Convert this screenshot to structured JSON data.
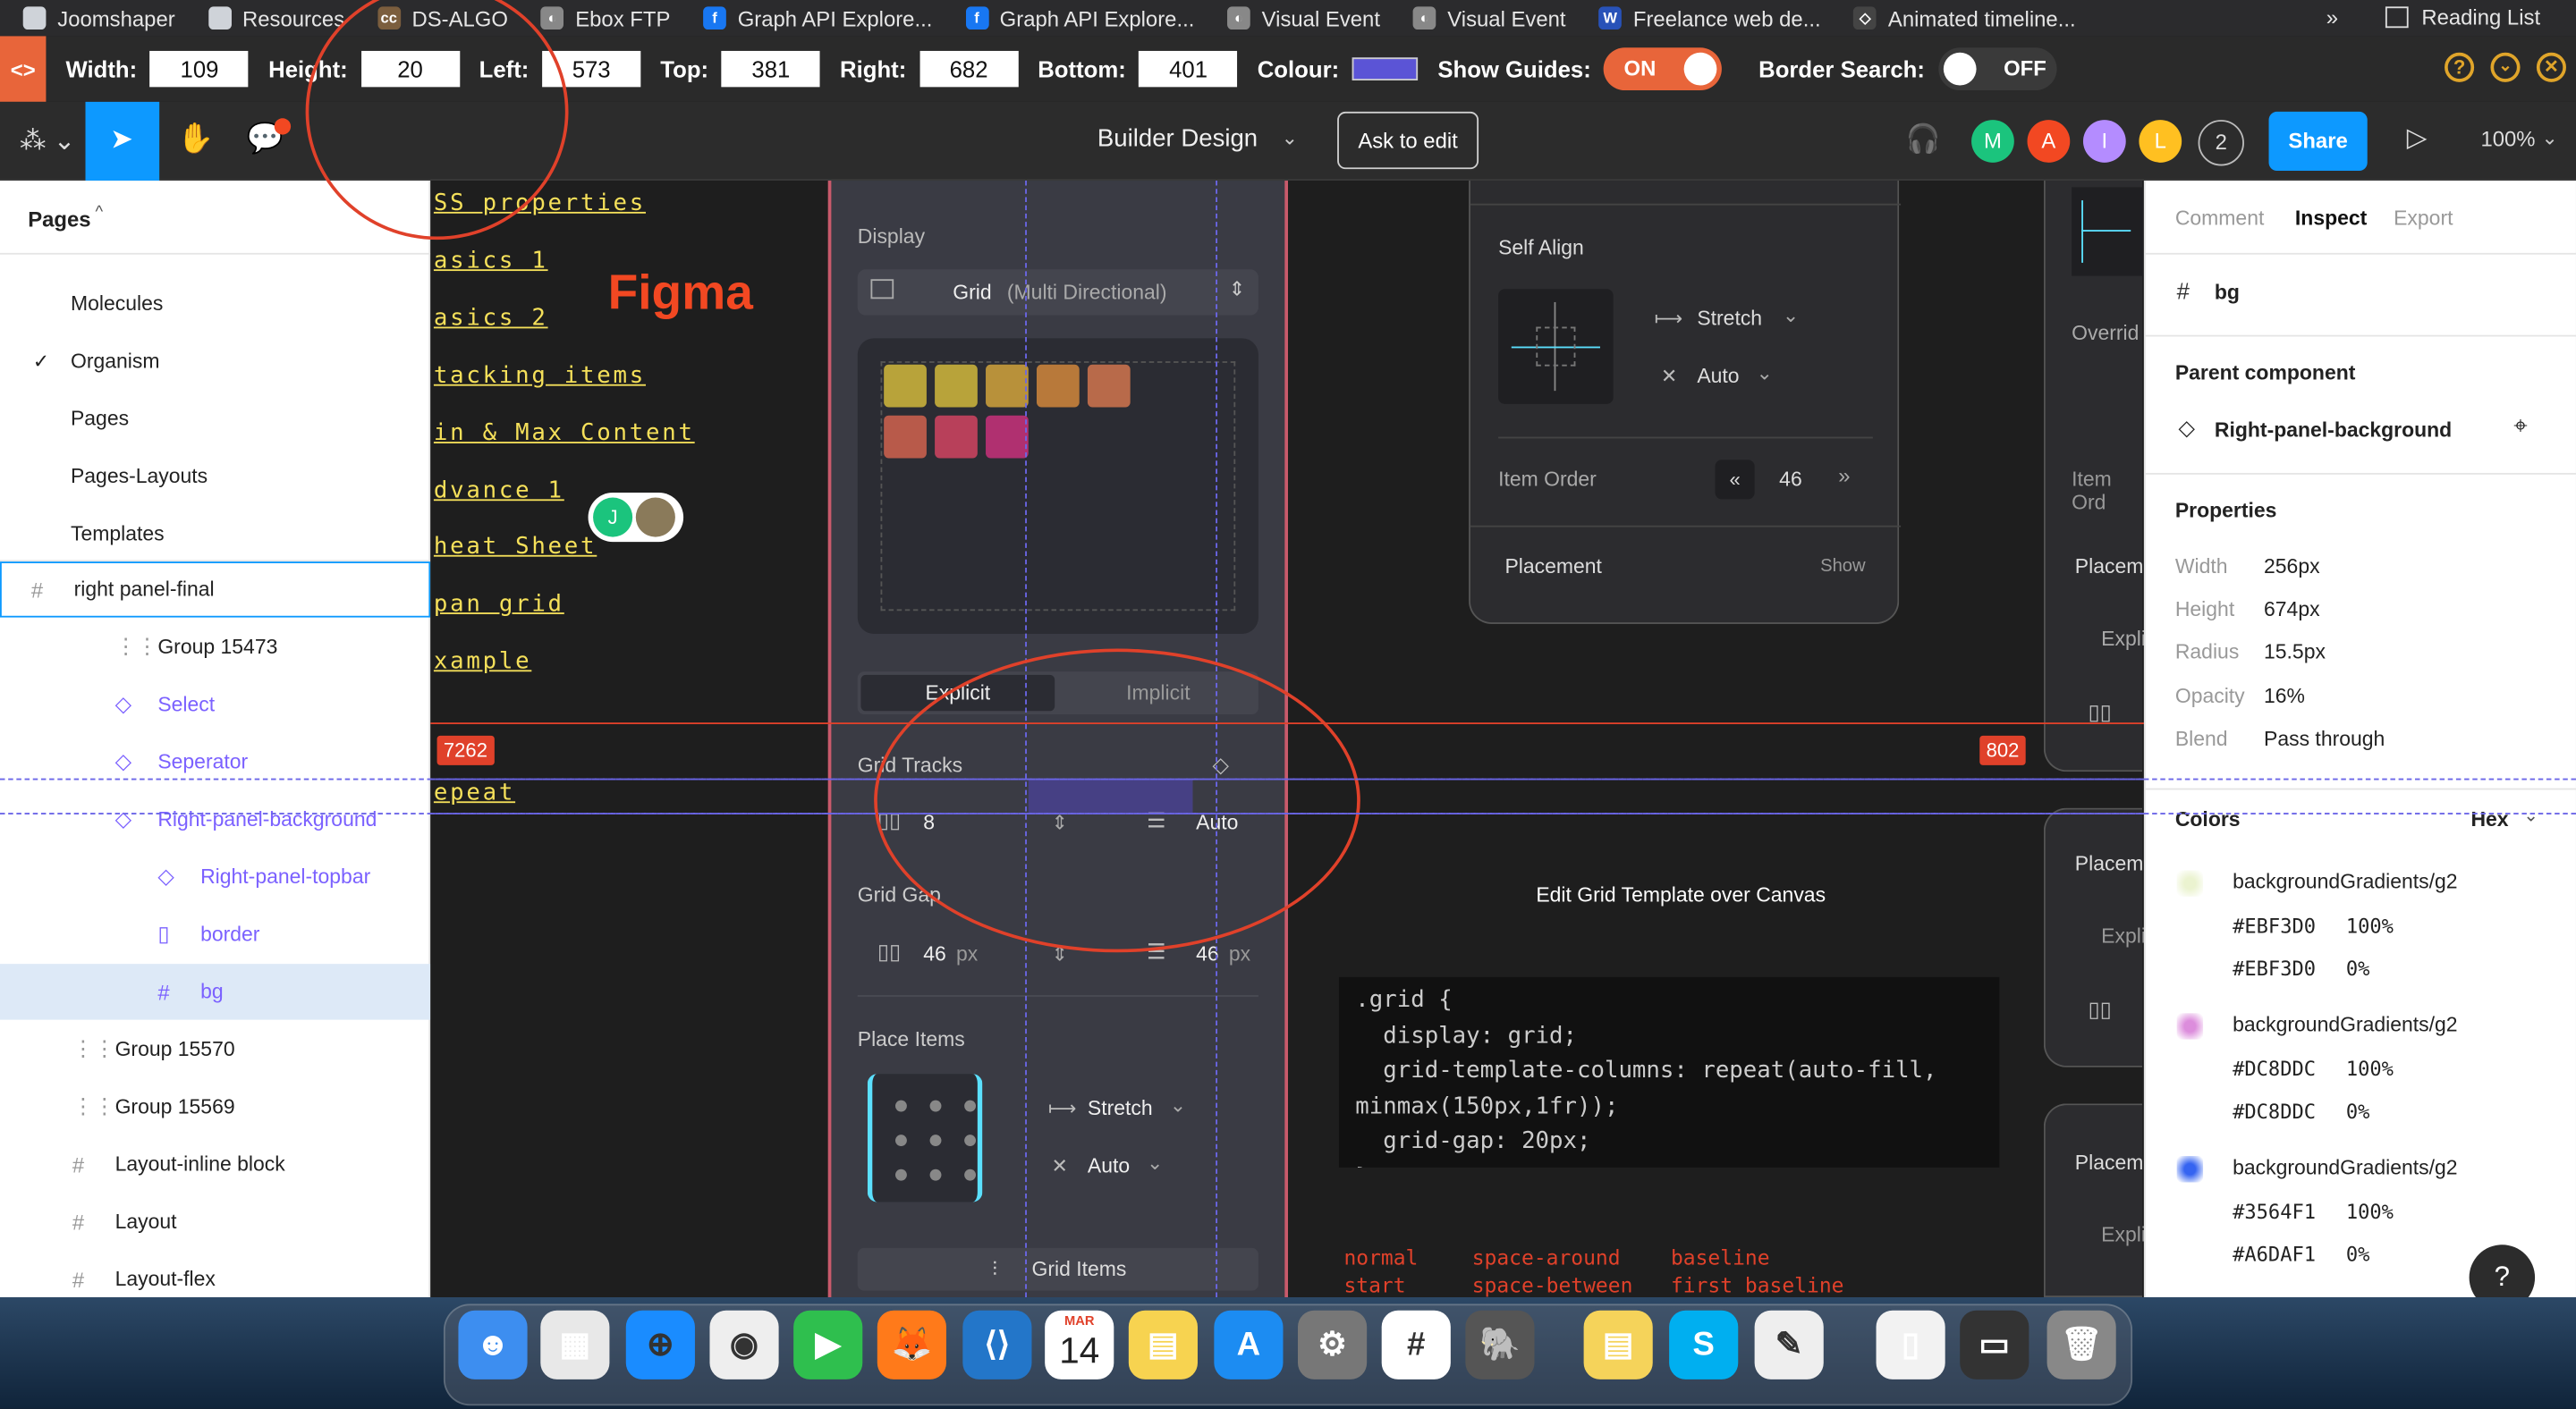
{
  "bookmarks": [
    {
      "label": "Joomshaper",
      "icon": "folder-icon"
    },
    {
      "label": "Resources",
      "icon": "folder-icon"
    },
    {
      "label": "DS-ALGO",
      "icon": "codechef-icon"
    },
    {
      "label": "Ebox FTP",
      "icon": "globe-icon"
    },
    {
      "label": "Graph API Explore...",
      "icon": "facebook-icon"
    },
    {
      "label": "Graph API Explore...",
      "icon": "facebook-icon"
    },
    {
      "label": "Visual Event",
      "icon": "globe-icon"
    },
    {
      "label": "Visual Event",
      "icon": "globe-icon"
    },
    {
      "label": "Freelance web de...",
      "icon": "w-icon"
    },
    {
      "label": "Animated timeline...",
      "icon": "codepen-icon"
    }
  ],
  "bookmarks_more": "»",
  "reading_list": "Reading List",
  "ext": {
    "width_label": "Width:",
    "width": "109",
    "height_label": "Height:",
    "height": "20",
    "left_label": "Left:",
    "left": "573",
    "top_label": "Top:",
    "top": "381",
    "right_label": "Right:",
    "right": "682",
    "bottom_label": "Bottom:",
    "bottom": "401",
    "colour_label": "Colour:",
    "colour": "#5b54d6",
    "guides_label": "Show Guides:",
    "guides": "ON",
    "border_label": "Border Search:",
    "border": "OFF"
  },
  "toolbar": {
    "title": "Builder Design",
    "ask": "Ask to edit",
    "share": "Share",
    "zoom": "100%",
    "avatars": [
      "M",
      "A",
      "I",
      "L"
    ],
    "count": "2"
  },
  "left": {
    "header": "Pages",
    "pages": [
      "Molecules",
      "Organism",
      "Pages",
      "Pages-Layouts",
      "Templates"
    ],
    "layers": [
      {
        "label": "right panel-final",
        "icon": "frame-icon",
        "indent": 0,
        "color": "#222"
      },
      {
        "label": "Group 15473",
        "icon": "group-icon",
        "indent": 1,
        "color": "#222"
      },
      {
        "label": "Select",
        "icon": "component-icon",
        "indent": 1,
        "color": "#7b61ff"
      },
      {
        "label": "Seperator",
        "icon": "component-icon",
        "indent": 1,
        "color": "#7b61ff"
      },
      {
        "label": "Right-panel-background",
        "icon": "component-icon",
        "indent": 1,
        "color": "#7b61ff"
      },
      {
        "label": "Right-panel-topbar",
        "icon": "component-icon",
        "indent": 2,
        "color": "#7b61ff"
      },
      {
        "label": "border",
        "icon": "rect-icon",
        "indent": 2,
        "color": "#7b61ff"
      },
      {
        "label": "bg",
        "icon": "frame-icon",
        "indent": 2,
        "color": "#7b61ff"
      },
      {
        "label": "Group 15570",
        "icon": "group-icon",
        "indent": 0,
        "color": "#222"
      },
      {
        "label": "Group 15569",
        "icon": "group-icon",
        "indent": 0,
        "color": "#222"
      },
      {
        "label": "Layout-inline block",
        "icon": "frame-icon",
        "indent": 0,
        "color": "#222"
      },
      {
        "label": "Layout",
        "icon": "frame-icon",
        "indent": 0,
        "color": "#222"
      },
      {
        "label": "Layout-flex",
        "icon": "frame-icon",
        "indent": 0,
        "color": "#222"
      }
    ]
  },
  "canvas": {
    "links": [
      "SS properties",
      "asics 1",
      "asics 2",
      "tacking items",
      "in & Max Content",
      "dvance 1",
      "heat Sheet",
      "pan grid",
      "xample"
    ],
    "repeat_link": "epeat",
    "figma_label": "Figma",
    "dim_left": "7262",
    "dim_right": "802",
    "avatars": [
      "J"
    ],
    "panel": {
      "display_label": "Display",
      "display_value": "Grid",
      "display_sub": "(Multi Directional)",
      "tab_explicit": "Explicit",
      "tab_implicit": "Implicit",
      "tracks_label": "Grid Tracks",
      "tracks_cols": "8",
      "tracks_rows": "Auto",
      "gap_label": "Grid Gap",
      "gap_col": "46",
      "gap_row": "46",
      "gap_unit": "px",
      "place_label": "Place Items",
      "place_h": "Stretch",
      "place_v": "Auto",
      "grid_items": "Grid Items"
    },
    "popup": {
      "self_align": "Self Align",
      "h": "Stretch",
      "v": "Auto",
      "order_label": "Item Order",
      "order": "46",
      "placement": "Placement",
      "show": "Show"
    },
    "side": {
      "override": "Overrid",
      "item_ord": "Item Ord",
      "place": "Placem",
      "expl": "Expli"
    },
    "edit_caption": "Edit Grid Template over Canvas",
    "code": [
      ".grid {",
      "  display: grid;",
      "  grid-template-columns: repeat(auto-fill,",
      "minmax(150px,1fr));",
      "  grid-gap: 20px;",
      "}"
    ],
    "keywords": [
      [
        "normal",
        "space-around",
        "baseline"
      ],
      [
        "start",
        "space-between",
        "first baseline"
      ]
    ]
  },
  "right": {
    "tabs": [
      "Comment",
      "Inspect",
      "Export"
    ],
    "layer": "bg",
    "parent_label": "Parent component",
    "parent": "Right-panel-background",
    "props_label": "Properties",
    "props": [
      [
        "Width",
        "256px"
      ],
      [
        "Height",
        "674px"
      ],
      [
        "Radius",
        "15.5px"
      ],
      [
        "Opacity",
        "16%"
      ],
      [
        "Blend",
        "Pass through"
      ]
    ],
    "colors_label": "Colors",
    "colors_mode": "Hex",
    "colors": [
      {
        "name": "backgroundGradients/g2",
        "swatch": "#EBF3D0",
        "stops": [
          [
            "#EBF3D0",
            "100%"
          ],
          [
            "#EBF3D0",
            "0%"
          ]
        ]
      },
      {
        "name": "backgroundGradients/g2",
        "swatch": "#DC8DDC",
        "stops": [
          [
            "#DC8DDC",
            "100%"
          ],
          [
            "#DC8DDC",
            "0%"
          ]
        ]
      },
      {
        "name": "backgroundGradients/g2",
        "swatch": "#3564F1",
        "stops": [
          [
            "#3564F1",
            "100%"
          ],
          [
            "#A6DAF1",
            "0%"
          ]
        ]
      }
    ],
    "help": "?"
  },
  "dock": {
    "calendar_month": "MAR",
    "calendar_day": "14",
    "apps": [
      "finder-icon",
      "launchpad-icon",
      "safari-icon",
      "chrome-icon",
      "facetime-icon",
      "firefox-icon",
      "vscode-icon",
      "calendar-icon",
      "notes-icon",
      "appstore-icon",
      "settings-icon",
      "slack-icon",
      "tableplus-icon",
      "stickies-icon",
      "skype-icon",
      "textedit-icon",
      "docx-icon",
      "screenshot-icon",
      "trash-icon"
    ]
  },
  "accent": "#0d99ff"
}
